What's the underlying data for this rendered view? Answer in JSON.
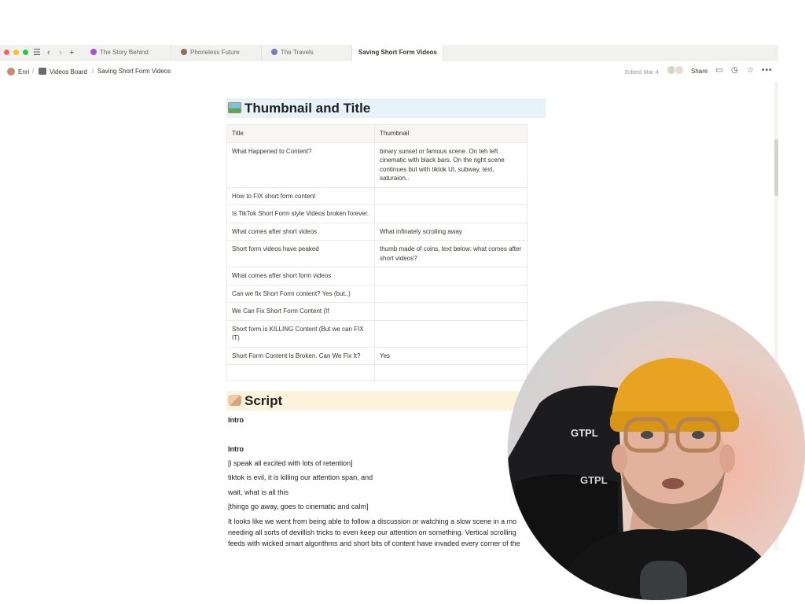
{
  "tabs": [
    {
      "label": "The Story Behind",
      "dot": "#a154d6"
    },
    {
      "label": "Phoneless Future",
      "dot": "#9a6a55"
    },
    {
      "label": "The Travels",
      "dot": "#6f7fb8"
    },
    {
      "label": "Saving Short Form Videos",
      "active": true
    }
  ],
  "breadcrumb": [
    "Enri",
    "Videos Board",
    "Saving Short Form Videos"
  ],
  "topbar": {
    "edited": "Edited Mar 4",
    "share": "Share"
  },
  "section1": {
    "title": "Thumbnail and Title",
    "columns": [
      "Title",
      "Thumbnail"
    ],
    "rows": [
      [
        "What Happened to Content?",
        "binary sunset or famous scene. On teh left cinematic with black bars. On the right scene continues but with tiktok UI, subway, text, saturaion.."
      ],
      [
        "How to FIX short form content",
        ""
      ],
      [
        "Is TikTok Short Form style Videos broken forever.",
        ""
      ],
      [
        "What comes after short videos",
        "What infinately scrolling away"
      ],
      [
        "Short form videos have peaked",
        "thumb made of coins, text below: what comes after short videos?"
      ],
      [
        "What comes after short form videos",
        ""
      ],
      [
        "Can we fix Short Form content? Yes (but..)",
        ""
      ],
      [
        "We Can Fix Short Form Content (If",
        ""
      ],
      [
        "Short form is KILLING Content (But we can FIX IT)",
        ""
      ],
      [
        "Short Form Content Is Broken. Can We Fix It?",
        "Yes"
      ],
      [
        "",
        ""
      ]
    ]
  },
  "section2": {
    "title": "Script",
    "intro1": "Intro",
    "intro2": "Intro",
    "lines": [
      "[i speak all excited with lots of retention]",
      "tiktok is evil, it is killing our attention span, and",
      "wait, what is all this",
      "[things go away, goes to cinematic and calm]",
      "It looks like we went from being able to follow a discussion or watching a slow scene in a mo",
      "needing all sorts of devillish tricks to even keep our attention on something. Vertical scrolling",
      "feeds with wicked smart algorithms and short bits of content have invaded every corner of the"
    ]
  },
  "webcam": {
    "beanie": "#e7a321",
    "shirt": "#151515"
  }
}
